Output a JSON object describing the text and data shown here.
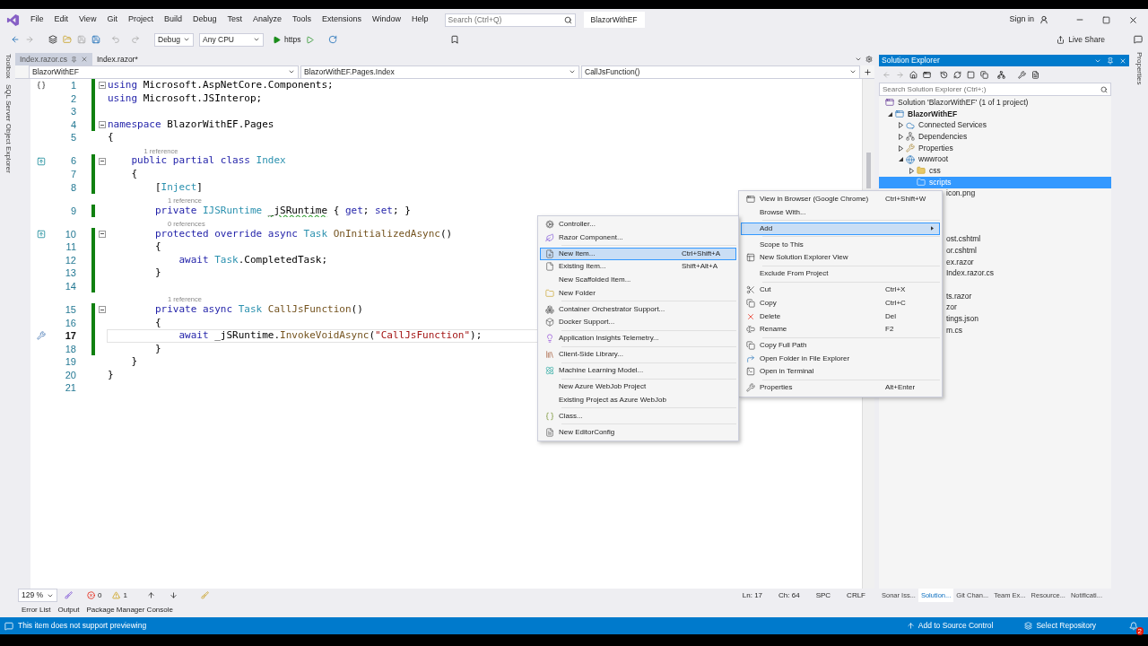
{
  "menu_bar": {
    "items": [
      "File",
      "Edit",
      "View",
      "Git",
      "Project",
      "Build",
      "Debug",
      "Test",
      "Analyze",
      "Tools",
      "Extensions",
      "Window",
      "Help"
    ],
    "search": {
      "placeholder": "Search (Ctrl+Q)"
    },
    "title": "BlazorWithEF",
    "sign_in": "Sign in"
  },
  "toolbar": {
    "configuration": "Debug",
    "platform": "Any CPU",
    "run_target": "https",
    "live_share": "Live Share"
  },
  "left_strip": [
    "Toolbox",
    "SQL Server Object Explorer"
  ],
  "right_strip": [
    "Properties"
  ],
  "editor": {
    "tabs": [
      {
        "label": "Index.razor.cs",
        "selected": true
      },
      {
        "label": "Index.razor*",
        "selected": false
      }
    ],
    "nav": [
      "BlazorWithEF",
      "BlazorWithEF.Pages.Index",
      "CallJsFunction()"
    ],
    "lines": [
      {
        "kind": "code",
        "n": "1",
        "changed": true,
        "fold": true,
        "current": false,
        "tokens": [
          {
            "kind": "kw",
            "text": "using"
          },
          {
            "kind": "plain",
            "text": " Microsoft.AspNetCore.Components;"
          }
        ]
      },
      {
        "kind": "code",
        "n": "2",
        "changed": true,
        "fold": false,
        "current": false,
        "tokens": [
          {
            "kind": "kw",
            "text": "using"
          },
          {
            "kind": "plain",
            "text": " Microsoft.JSInterop;"
          }
        ]
      },
      {
        "kind": "code",
        "n": "3",
        "changed": true,
        "fold": false,
        "current": false
      },
      {
        "kind": "code",
        "n": "4",
        "changed": true,
        "fold": true,
        "current": false,
        "tokens": [
          {
            "kind": "kw",
            "text": "namespace"
          },
          {
            "kind": "plain",
            "text": " BlazorWithEF.Pages"
          }
        ]
      },
      {
        "kind": "code",
        "n": "5",
        "changed": false,
        "fold": false,
        "current": false,
        "tokens": [
          {
            "kind": "plain",
            "text": "{"
          }
        ]
      },
      {
        "kind": "lens",
        "text": "1 reference"
      },
      {
        "kind": "code",
        "n": "6",
        "changed": true,
        "fold": true,
        "current": false,
        "tokens": [
          {
            "kind": "kw",
            "text": "    public partial class "
          },
          {
            "kind": "type",
            "text": "Index"
          }
        ]
      },
      {
        "kind": "code",
        "n": "7",
        "changed": true,
        "fold": false,
        "current": false,
        "tokens": [
          {
            "kind": "plain",
            "text": "    {"
          }
        ]
      },
      {
        "kind": "code",
        "n": "8",
        "changed": true,
        "fold": false,
        "current": false,
        "tokens": [
          {
            "kind": "plain",
            "text": "        ["
          },
          {
            "kind": "type",
            "text": "Inject"
          },
          {
            "kind": "plain",
            "text": "]"
          }
        ]
      },
      {
        "kind": "lens",
        "text": "1 reference"
      },
      {
        "kind": "code",
        "n": "9",
        "changed": true,
        "fold": false,
        "current": false,
        "tokens": [
          {
            "kind": "kw",
            "text": "        private "
          },
          {
            "kind": "type",
            "text": "IJSRuntime "
          },
          {
            "kind": "warn",
            "text": "_jSRuntime"
          },
          {
            "kind": "plain",
            "text": " { "
          },
          {
            "kind": "kw",
            "text": "get"
          },
          {
            "kind": "plain",
            "text": "; "
          },
          {
            "kind": "kw",
            "text": "set"
          },
          {
            "kind": "plain",
            "text": "; }"
          }
        ]
      },
      {
        "kind": "lens",
        "text": "0 references"
      },
      {
        "kind": "code",
        "n": "10",
        "changed": true,
        "fold": true,
        "current": false,
        "tokens": [
          {
            "kind": "kw",
            "text": "        protected override async "
          },
          {
            "kind": "type",
            "text": "Task "
          },
          {
            "kind": "method",
            "text": "OnInitializedAsync"
          },
          {
            "kind": "plain",
            "text": "()"
          }
        ]
      },
      {
        "kind": "code",
        "n": "11",
        "changed": true,
        "fold": false,
        "current": false,
        "tokens": [
          {
            "kind": "plain",
            "text": "        {"
          }
        ]
      },
      {
        "kind": "code",
        "n": "12",
        "changed": true,
        "fold": false,
        "current": false,
        "tokens": [
          {
            "kind": "kw",
            "text": "            await "
          },
          {
            "kind": "type",
            "text": "Task"
          },
          {
            "kind": "plain",
            "text": ".CompletedTask;"
          }
        ]
      },
      {
        "kind": "code",
        "n": "13",
        "changed": true,
        "fold": false,
        "current": false,
        "tokens": [
          {
            "kind": "plain",
            "text": "        }"
          }
        ]
      },
      {
        "kind": "code",
        "n": "14",
        "changed": true,
        "fold": false,
        "current": false
      },
      {
        "kind": "lens",
        "text": "1 reference"
      },
      {
        "kind": "code",
        "n": "15",
        "changed": true,
        "fold": true,
        "current": false,
        "tokens": [
          {
            "kind": "kw",
            "text": "        private async "
          },
          {
            "kind": "type",
            "text": "Task "
          },
          {
            "kind": "method",
            "text": "CallJsFunction"
          },
          {
            "kind": "plain",
            "text": "()"
          }
        ]
      },
      {
        "kind": "code",
        "n": "16",
        "changed": true,
        "fold": false,
        "current": false,
        "tokens": [
          {
            "kind": "plain",
            "text": "        {"
          }
        ]
      },
      {
        "kind": "code",
        "n": "17",
        "changed": true,
        "fold": false,
        "current": true,
        "tokens": [
          {
            "kind": "kw",
            "text": "            await"
          },
          {
            "kind": "plain",
            "text": " _jSRuntime."
          },
          {
            "kind": "method",
            "text": "InvokeVoidAsync"
          },
          {
            "kind": "plain",
            "text": "("
          },
          {
            "kind": "str",
            "text": "\"CallJsFunction\""
          },
          {
            "kind": "plain",
            "text": ");"
          }
        ]
      },
      {
        "kind": "code",
        "n": "18",
        "changed": true,
        "fold": false,
        "current": false,
        "tokens": [
          {
            "kind": "plain",
            "text": "        }"
          }
        ]
      },
      {
        "kind": "code",
        "n": "19",
        "changed": false,
        "fold": false,
        "current": false,
        "tokens": [
          {
            "kind": "plain",
            "text": "    }"
          }
        ]
      },
      {
        "kind": "code",
        "n": "20",
        "changed": false,
        "fold": false,
        "current": false,
        "tokens": [
          {
            "kind": "plain",
            "text": "}"
          }
        ]
      },
      {
        "kind": "code",
        "n": "21",
        "changed": false,
        "fold": false,
        "current": false
      }
    ],
    "status": {
      "zoom": "129 %",
      "errors": "0",
      "warnings": "1",
      "line": "Ln: 17",
      "column": "Ch: 64",
      "whitespace": "SPC",
      "line_endings": "CRLF"
    }
  },
  "tool_tabs": [
    "Error List",
    "Output",
    "Package Manager Console"
  ],
  "solution_explorer": {
    "title": "Solution Explorer",
    "search": {
      "placeholder": "Search Solution Explorer (Ctrl+;)"
    },
    "tree": [
      {
        "kind": "solution",
        "label": "Solution 'BlazorWithEF' (1 of 1 project)",
        "selected": false,
        "children": [
          {
            "kind": "project",
            "label": "BlazorWithEF",
            "expanded": true,
            "selected": false,
            "children": [
              {
                "kind": "connected",
                "label": "Connected Services",
                "expanded": false,
                "selected": false
              },
              {
                "kind": "dependencies",
                "label": "Dependencies",
                "expanded": false,
                "selected": false
              },
              {
                "kind": "properties",
                "label": "Properties",
                "expanded": false,
                "selected": false
              },
              {
                "kind": "web",
                "label": "wwwroot",
                "expanded": true,
                "selected": false,
                "children": [
                  {
                    "kind": "folder",
                    "label": "css",
                    "expanded": false,
                    "selected": false
                  },
                  {
                    "kind": "folder",
                    "label": "scripts",
                    "selected": true
                  }
                ]
              }
            ]
          }
        ]
      }
    ],
    "covered_rows": [
      {
        "kind": "partial",
        "text": "icon.png"
      },
      {
        "kind": "hidden"
      },
      {
        "kind": "hidden"
      },
      {
        "kind": "hidden"
      },
      {
        "kind": "partial",
        "text": "ost.cshtml"
      },
      {
        "kind": "partial",
        "text": "or.cshtml"
      },
      {
        "kind": "partial",
        "text": "ex.razor"
      },
      {
        "kind": "partial",
        "text": "Index.razor.cs"
      },
      {
        "kind": "hidden"
      },
      {
        "kind": "partial",
        "text": "ts.razor"
      },
      {
        "kind": "partial",
        "text": "zor"
      },
      {
        "kind": "partial",
        "text": "tings.json"
      },
      {
        "kind": "partial",
        "text": "m.cs"
      }
    ],
    "tabs": [
      {
        "label": "Sonar Iss...",
        "selected": false
      },
      {
        "label": "Solution...",
        "selected": true
      },
      {
        "label": "Git Chan...",
        "selected": false
      },
      {
        "label": "Team Ex...",
        "selected": false
      },
      {
        "label": "Resource...",
        "selected": false
      },
      {
        "label": "Notificati...",
        "selected": false
      }
    ]
  },
  "context_menu": {
    "items": [
      {
        "kind": "item",
        "label": "View in Browser (Google Chrome)",
        "shortcut": "Ctrl+Shift+W",
        "selected": false,
        "submenu": false
      },
      {
        "kind": "item",
        "label": "Browse With...",
        "selected": false,
        "submenu": false
      },
      {
        "kind": "separator"
      },
      {
        "kind": "item",
        "label": "Add",
        "selected": true,
        "submenu": true
      },
      {
        "kind": "separator"
      },
      {
        "kind": "item",
        "label": "Scope to This",
        "selected": false,
        "submenu": false
      },
      {
        "kind": "item",
        "label": "New Solution Explorer View",
        "selected": false,
        "submenu": false
      },
      {
        "kind": "separator"
      },
      {
        "kind": "item",
        "label": "Exclude From Project",
        "selected": false,
        "submenu": false
      },
      {
        "kind": "separator"
      },
      {
        "kind": "item",
        "label": "Cut",
        "shortcut": "Ctrl+X",
        "selected": false,
        "submenu": false
      },
      {
        "kind": "item",
        "label": "Copy",
        "shortcut": "Ctrl+C",
        "selected": false,
        "submenu": false
      },
      {
        "kind": "item",
        "label": "Delete",
        "shortcut": "Del",
        "selected": false,
        "submenu": false
      },
      {
        "kind": "item",
        "label": "Rename",
        "shortcut": "F2",
        "selected": false,
        "submenu": false
      },
      {
        "kind": "separator"
      },
      {
        "kind": "item",
        "label": "Copy Full Path",
        "selected": false,
        "submenu": false
      },
      {
        "kind": "item",
        "label": "Open Folder in File Explorer",
        "selected": false,
        "submenu": false
      },
      {
        "kind": "item",
        "label": "Open in Terminal",
        "selected": false,
        "submenu": false
      },
      {
        "kind": "separator"
      },
      {
        "kind": "item",
        "label": "Properties",
        "shortcut": "Alt+Enter",
        "selected": false,
        "submenu": false
      }
    ]
  },
  "add_submenu": {
    "items": [
      {
        "kind": "item",
        "label": "Controller...",
        "selected": false
      },
      {
        "kind": "item",
        "label": "Razor Component...",
        "selected": false
      },
      {
        "kind": "separator"
      },
      {
        "kind": "item",
        "label": "New Item...",
        "shortcut": "Ctrl+Shift+A",
        "selected": true
      },
      {
        "kind": "item",
        "label": "Existing Item...",
        "shortcut": "Shift+Alt+A",
        "selected": false
      },
      {
        "kind": "item",
        "label": "New Scaffolded Item...",
        "selected": false
      },
      {
        "kind": "item",
        "label": "New Folder",
        "selected": false
      },
      {
        "kind": "separator"
      },
      {
        "kind": "item",
        "label": "Container Orchestrator Support...",
        "selected": false
      },
      {
        "kind": "item",
        "label": "Docker Support...",
        "selected": false
      },
      {
        "kind": "separator"
      },
      {
        "kind": "item",
        "label": "Application Insights Telemetry...",
        "selected": false
      },
      {
        "kind": "separator"
      },
      {
        "kind": "item",
        "label": "Client-Side Library...",
        "selected": false
      },
      {
        "kind": "separator"
      },
      {
        "kind": "item",
        "label": "Machine Learning Model...",
        "selected": false
      },
      {
        "kind": "separator"
      },
      {
        "kind": "item",
        "label": "New Azure WebJob Project",
        "selected": false
      },
      {
        "kind": "item",
        "label": "Existing Project as Azure WebJob",
        "selected": false
      },
      {
        "kind": "separator"
      },
      {
        "kind": "item",
        "label": "Class...",
        "selected": false
      },
      {
        "kind": "separator"
      },
      {
        "kind": "item",
        "label": "New EditorConfig",
        "selected": false
      }
    ]
  },
  "status_bar": {
    "message": "This item does not support previewing",
    "source_control": "Add to Source Control",
    "repository": "Select Repository",
    "notifications": "2"
  }
}
